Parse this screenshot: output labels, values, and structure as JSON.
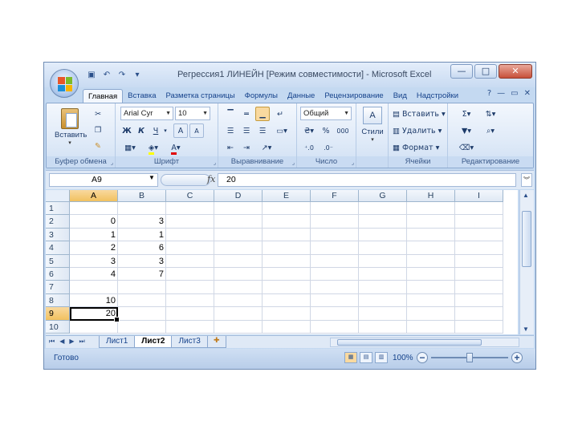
{
  "window": {
    "title": "Регрессия1 ЛИНЕЙН  [Режим совместимости] - Microsoft Excel"
  },
  "quick_access": [
    "save-icon",
    "undo-icon",
    "redo-icon",
    "customize-icon"
  ],
  "ribbon": {
    "tabs": [
      {
        "label": "Главная",
        "active": true
      },
      {
        "label": "Вставка"
      },
      {
        "label": "Разметка страницы"
      },
      {
        "label": "Формулы"
      },
      {
        "label": "Данные"
      },
      {
        "label": "Рецензирование"
      },
      {
        "label": "Вид"
      },
      {
        "label": "Надстройки"
      }
    ],
    "clipboard": {
      "label": "Буфер обмена",
      "paste": "Вставить"
    },
    "font": {
      "label": "Шрифт",
      "name": "Arial Cyr",
      "size": "10",
      "bold": "Ж",
      "italic": "К",
      "underline": "Ч",
      "grow": "A",
      "shrink": "A"
    },
    "alignment": {
      "label": "Выравнивание"
    },
    "number": {
      "label": "Число",
      "format": "Общий",
      "percent": "%",
      "thousands": "000"
    },
    "styles": {
      "label": "Стили"
    },
    "cells": {
      "label": "Ячейки",
      "insert": "Вставить",
      "delete": "Удалить",
      "format": "Формат"
    },
    "editing": {
      "label": "Редактирование"
    }
  },
  "formula_bar": {
    "name_box": "A9",
    "fx": "fx",
    "value": "20"
  },
  "grid": {
    "columns": [
      "A",
      "B",
      "C",
      "D",
      "E",
      "F",
      "G",
      "H",
      "I"
    ],
    "active_column": "A",
    "rows": [
      {
        "num": "1",
        "cells": [
          "",
          ""
        ]
      },
      {
        "num": "2",
        "cells": [
          "0",
          "3"
        ]
      },
      {
        "num": "3",
        "cells": [
          "1",
          "1"
        ]
      },
      {
        "num": "4",
        "cells": [
          "2",
          "6"
        ]
      },
      {
        "num": "5",
        "cells": [
          "3",
          "3"
        ]
      },
      {
        "num": "6",
        "cells": [
          "4",
          "7"
        ]
      },
      {
        "num": "7",
        "cells": [
          "",
          ""
        ]
      },
      {
        "num": "8",
        "cells": [
          "10",
          ""
        ]
      },
      {
        "num": "9",
        "cells": [
          "20",
          ""
        ]
      },
      {
        "num": "10",
        "cells": [
          "",
          ""
        ]
      }
    ],
    "active_row": "9"
  },
  "sheets": {
    "tabs": [
      {
        "label": "Лист1"
      },
      {
        "label": "Лист2",
        "active": true
      },
      {
        "label": "Лист3"
      }
    ]
  },
  "status": {
    "text": "Готово",
    "zoom": "100%",
    "zoom_fraction": 0.5
  },
  "colors": {
    "selected_header": "#f1c15f",
    "window_frame": "#c4d9f1",
    "close_button": "#c7503a"
  }
}
